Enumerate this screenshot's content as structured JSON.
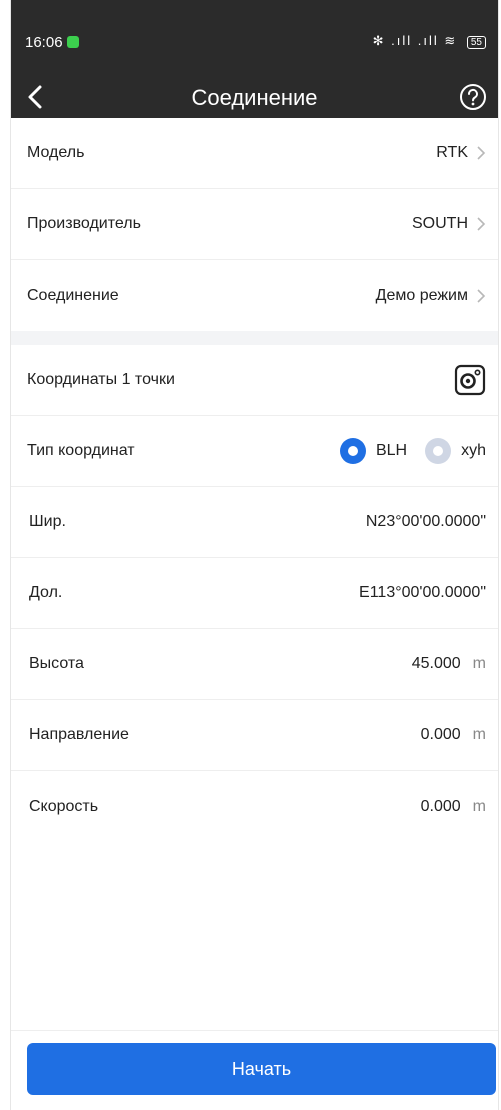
{
  "status": {
    "time": "16:06",
    "signal": "✻ .ıll .ıll ≋",
    "battery": "55"
  },
  "appbar": {
    "title": "Соединение"
  },
  "device": {
    "model": {
      "label": "Модель",
      "value": "RTK"
    },
    "maker": {
      "label": "Производитель",
      "value": "SOUTH"
    },
    "connection": {
      "label": "Соединение",
      "value": "Демо режим"
    }
  },
  "point": {
    "coords_label": "Координаты 1 точки",
    "coord_type_label": "Тип координат",
    "options": [
      {
        "label": "BLH",
        "selected": true
      },
      {
        "label": "xyh",
        "selected": false
      }
    ],
    "lat": {
      "label": "Шир.",
      "value": "N23°00'00.0000\""
    },
    "lon": {
      "label": "Дол.",
      "value": "E113°00'00.0000\""
    },
    "height": {
      "label": "Высота",
      "value": "45.000",
      "unit": "m"
    },
    "direction": {
      "label": "Направление",
      "value": "0.000",
      "unit": "m"
    },
    "speed": {
      "label": "Скорость",
      "value": "0.000",
      "unit": "m"
    }
  },
  "footer": {
    "start_label": "Начать"
  },
  "colors": {
    "accent": "#1f6fe3",
    "header": "#2b2b2b"
  }
}
